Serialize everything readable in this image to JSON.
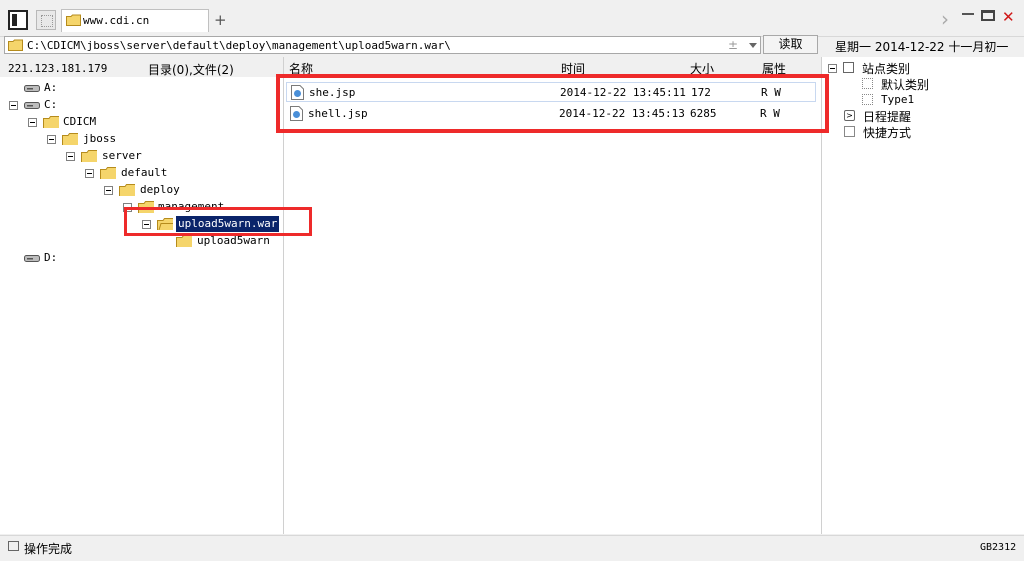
{
  "tab": {
    "title": "www.cdi.cn",
    "add_label": "+"
  },
  "window_controls": {
    "forward": "›",
    "minimize": "—",
    "maximize": "□",
    "close": "✕"
  },
  "address": {
    "path": "C:\\CDICM\\jboss\\server\\default\\deploy\\management\\upload5warn.war\\",
    "plusminus": "±"
  },
  "read_button": "读取",
  "date_line": "星期一  2014-12-22  十一月初一",
  "ip": "221.123.181.179",
  "dir_summary": "目录(0),文件(2)",
  "columns": {
    "name": "名称",
    "time": "时间",
    "size": "大小",
    "attr": "属性"
  },
  "files": [
    {
      "name": "she.jsp",
      "time": "2014-12-22 13:45:11",
      "size": "172",
      "attr": "R W"
    },
    {
      "name": "shell.jsp",
      "time": "2014-12-22 13:45:13",
      "size": "6285",
      "attr": "R W"
    }
  ],
  "tree": {
    "a": "A:",
    "c": "C:",
    "cdicm": "CDICM",
    "jboss": "jboss",
    "server": "server",
    "default": "default",
    "deploy": "deploy",
    "management": "management",
    "upload_war": "upload5warn.war",
    "upload5warn": "upload5warn",
    "d": "D:"
  },
  "right_panel": {
    "site_categories": "站点类别",
    "default_category": "默认类别",
    "type1": "Type1",
    "schedule": "日程提醒",
    "shortcuts": "快捷方式"
  },
  "status": {
    "text": "操作完成",
    "encoding": "GB2312"
  },
  "colors": {
    "highlight_red": "#ee2a2a",
    "selection_bg": "#0a246a",
    "folder_yellow": "#f5d56b"
  }
}
